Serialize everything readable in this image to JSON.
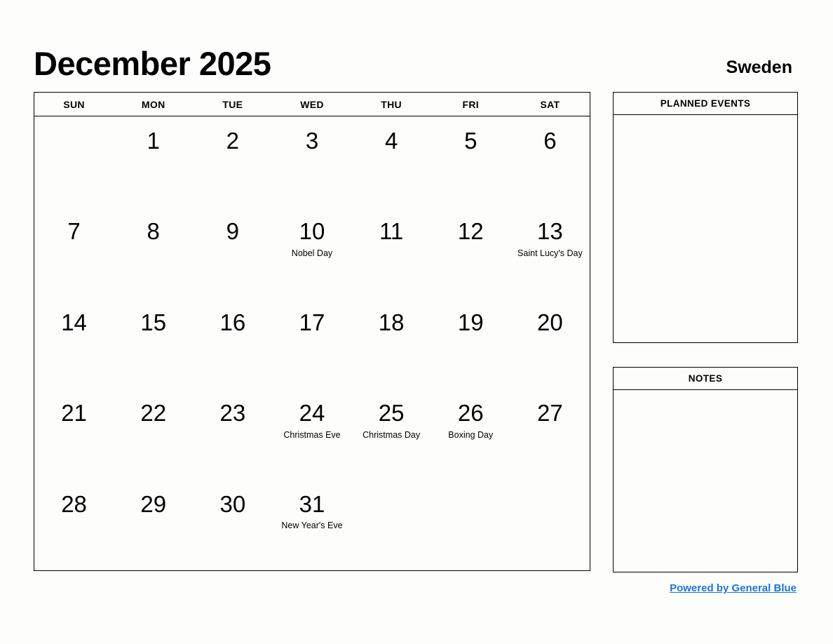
{
  "header": {
    "month_title": "December 2025",
    "country": "Sweden"
  },
  "calendar": {
    "weekdays": [
      "SUN",
      "MON",
      "TUE",
      "WED",
      "THU",
      "FRI",
      "SAT"
    ],
    "weeks": [
      [
        {
          "day": "",
          "event": ""
        },
        {
          "day": "1",
          "event": ""
        },
        {
          "day": "2",
          "event": ""
        },
        {
          "day": "3",
          "event": ""
        },
        {
          "day": "4",
          "event": ""
        },
        {
          "day": "5",
          "event": ""
        },
        {
          "day": "6",
          "event": ""
        }
      ],
      [
        {
          "day": "7",
          "event": ""
        },
        {
          "day": "8",
          "event": ""
        },
        {
          "day": "9",
          "event": ""
        },
        {
          "day": "10",
          "event": "Nobel Day"
        },
        {
          "day": "11",
          "event": ""
        },
        {
          "day": "12",
          "event": ""
        },
        {
          "day": "13",
          "event": "Saint Lucy's Day"
        }
      ],
      [
        {
          "day": "14",
          "event": ""
        },
        {
          "day": "15",
          "event": ""
        },
        {
          "day": "16",
          "event": ""
        },
        {
          "day": "17",
          "event": ""
        },
        {
          "day": "18",
          "event": ""
        },
        {
          "day": "19",
          "event": ""
        },
        {
          "day": "20",
          "event": ""
        }
      ],
      [
        {
          "day": "21",
          "event": ""
        },
        {
          "day": "22",
          "event": ""
        },
        {
          "day": "23",
          "event": ""
        },
        {
          "day": "24",
          "event": "Christmas Eve"
        },
        {
          "day": "25",
          "event": "Christmas Day"
        },
        {
          "day": "26",
          "event": "Boxing Day"
        },
        {
          "day": "27",
          "event": ""
        }
      ],
      [
        {
          "day": "28",
          "event": ""
        },
        {
          "day": "29",
          "event": ""
        },
        {
          "day": "30",
          "event": ""
        },
        {
          "day": "31",
          "event": "New Year's Eve"
        },
        {
          "day": "",
          "event": ""
        },
        {
          "day": "",
          "event": ""
        },
        {
          "day": "",
          "event": ""
        }
      ]
    ]
  },
  "panels": {
    "planned_events_title": "PLANNED EVENTS",
    "notes_title": "NOTES"
  },
  "footer": {
    "link_label": "Powered by General Blue",
    "link_color": "#2175c8"
  }
}
